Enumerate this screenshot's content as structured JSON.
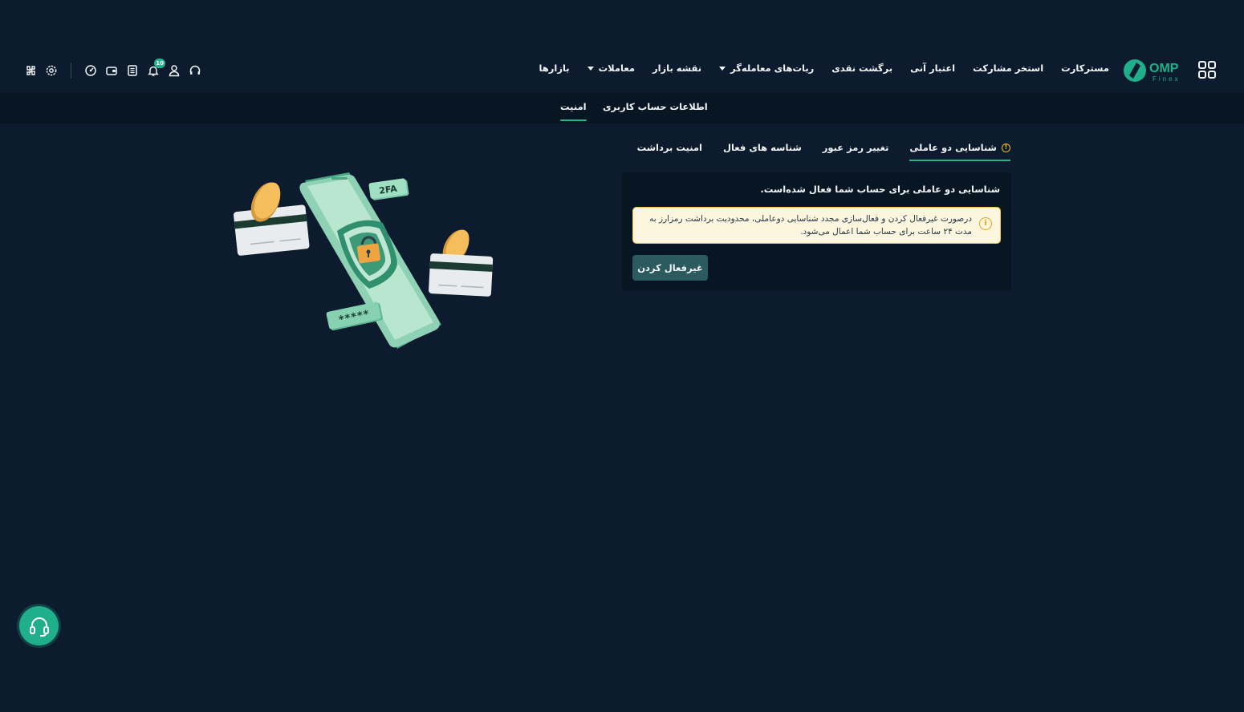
{
  "header": {
    "logo": {
      "text": "OMP",
      "subtext": "Finex"
    },
    "nav": [
      {
        "label": "بازارها",
        "has_dropdown": false
      },
      {
        "label": "معاملات",
        "has_dropdown": true
      },
      {
        "label": "نقشه بازار",
        "has_dropdown": false
      },
      {
        "label": "ربات‌های معامله‌گر",
        "has_dropdown": true
      },
      {
        "label": "برگشت نقدی",
        "has_dropdown": false
      },
      {
        "label": "اعتبار آنی",
        "has_dropdown": false
      },
      {
        "label": "استخر مشارکت",
        "has_dropdown": false
      },
      {
        "label": "مسترکارت",
        "has_dropdown": false
      }
    ],
    "tools": {
      "notification_count": "10",
      "icons": [
        "support-icon",
        "user-icon",
        "bell-icon",
        "report-icon",
        "wallet-icon",
        "dashboard-icon",
        "settings-icon",
        "puzzle-icon"
      ]
    }
  },
  "subnav": {
    "tabs": [
      {
        "label": "اطلاعات حساب کاربری",
        "active": false
      },
      {
        "label": "امنیت",
        "active": true
      }
    ]
  },
  "security": {
    "tabs": [
      {
        "label": "شناسایی دو عاملی",
        "active": true,
        "warning": true
      },
      {
        "label": "تغییر رمز عبور",
        "active": false
      },
      {
        "label": "شناسه های فعال",
        "active": false
      },
      {
        "label": "امنیت برداشت",
        "active": false
      }
    ],
    "card": {
      "title": "شناسایی دو عاملی برای حساب شما فعال شده‌است.",
      "alert_text": "درصورت غیرفعال کردن و فعال‌سازی مجدد شناسایی دوعاملی، محدودیت برداشت رمزارز به مدت ۲۴ ساعت برای حساب شما اعمال می‌شود.",
      "button_label": "غیرفعال کردن"
    }
  },
  "illustration": {
    "badge_2fa": "2FA",
    "password_mask": "*****"
  },
  "colors": {
    "background": "#0c1c2e",
    "panel": "#081624",
    "accent": "#22b48c",
    "warning": "#f2b92f",
    "alert_bg": "#fdf6df",
    "button": "#2b5a5f"
  }
}
